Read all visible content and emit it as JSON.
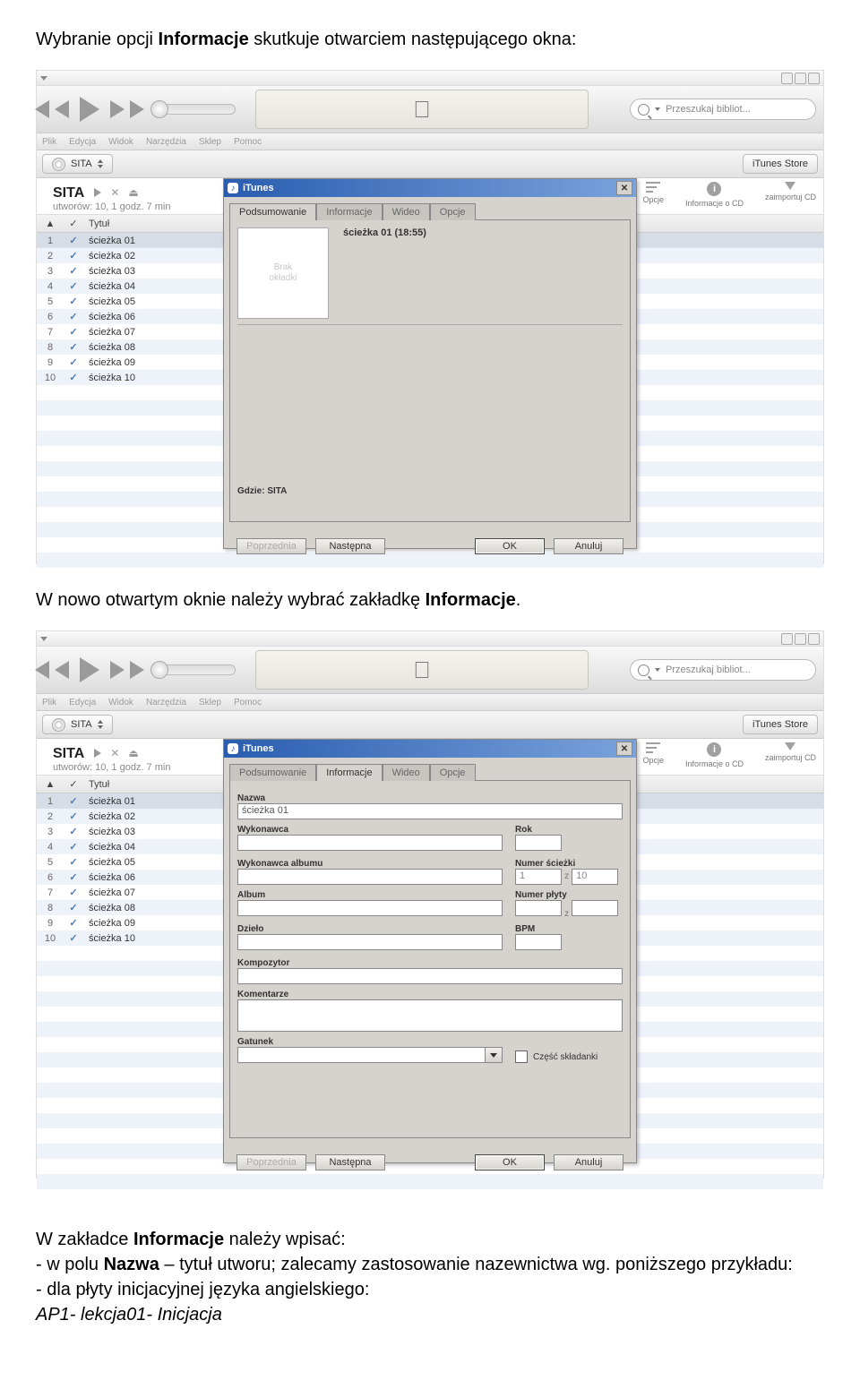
{
  "doc": {
    "p1a": "Wybranie opcji ",
    "p1b": "Informacje",
    "p1c": " skutkuje otwarciem następującego okna:",
    "p2a": "W nowo otwartym oknie należy wybrać zakładkę ",
    "p2b": "Informacje",
    "p2c": ".",
    "p3a": "W zakładce ",
    "p3b": "Informacje",
    "p3c": " należy wpisać:",
    "p4a": "- w polu ",
    "p4b": "Nazwa",
    "p4c": " – tytuł utworu; zalecamy zastosowanie nazewnictwa wg. poniższego przykładu:",
    "p5": "- dla płyty inicjacyjnej języka angielskiego:",
    "p6": "AP1- lekcja01- Inicjacja"
  },
  "app": {
    "search_placeholder": "Przeszukaj bibliot...",
    "menu": {
      "plik": "Plik",
      "edycja": "Edycja",
      "widok": "Widok",
      "narzedzia": "Narzędzia",
      "sklep": "Sklep",
      "pomoc": "Pomoc"
    },
    "source_name": "SITA",
    "store_button": "iTunes Store",
    "playlist_name": "SITA",
    "playlist_sub": "utworów: 10, 1 godz. 7 min",
    "col_sort": "▲",
    "col_check": "✓",
    "col_title": "Tytuł",
    "tracks": [
      {
        "n": "1",
        "title": "ścieżka 01"
      },
      {
        "n": "2",
        "title": "ścieżka 02"
      },
      {
        "n": "3",
        "title": "ścieżka 03"
      },
      {
        "n": "4",
        "title": "ścieżka 04"
      },
      {
        "n": "5",
        "title": "ścieżka 05"
      },
      {
        "n": "6",
        "title": "ścieżka 06"
      },
      {
        "n": "7",
        "title": "ścieżka 07"
      },
      {
        "n": "8",
        "title": "ścieżka 08"
      },
      {
        "n": "9",
        "title": "ścieżka 09"
      },
      {
        "n": "10",
        "title": "ścieżka 10"
      }
    ],
    "right": {
      "opcje": "Opcje",
      "info": "Informacje o CD",
      "import": "zaimportuj CD"
    }
  },
  "dialog1": {
    "title": "iTunes",
    "tabs": {
      "podsumowanie": "Podsumowanie",
      "informacje": "Informacje",
      "wideo": "Wideo",
      "opcje": "Opcje"
    },
    "no_art": "Brak\nokładki",
    "track_label": "ścieżka 01 (18:55)",
    "where": "Gdzie: SITA",
    "btn_prev": "Poprzednia",
    "btn_next": "Następna",
    "btn_ok": "OK",
    "btn_cancel": "Anuluj"
  },
  "dialog2": {
    "title": "iTunes",
    "tabs": {
      "podsumowanie": "Podsumowanie",
      "informacje": "Informacje",
      "wideo": "Wideo",
      "opcje": "Opcje"
    },
    "labels": {
      "nazwa": "Nazwa",
      "wykonawca": "Wykonawca",
      "rok": "Rok",
      "walbum": "Wykonawca albumu",
      "nrtrack": "Numer ścieżki",
      "album": "Album",
      "nrplyty": "Numer płyty",
      "dzielo": "Dzieło",
      "bpm": "BPM",
      "kompozytor": "Kompozytor",
      "komentarze": "Komentarze",
      "gatunek": "Gatunek",
      "skladanka": "Część składanki",
      "z": "z"
    },
    "values": {
      "nazwa": "ścieżka 01",
      "track_of_a": "1",
      "track_of_b": "10"
    },
    "btn_prev": "Poprzednia",
    "btn_next": "Następna",
    "btn_ok": "OK",
    "btn_cancel": "Anuluj"
  }
}
